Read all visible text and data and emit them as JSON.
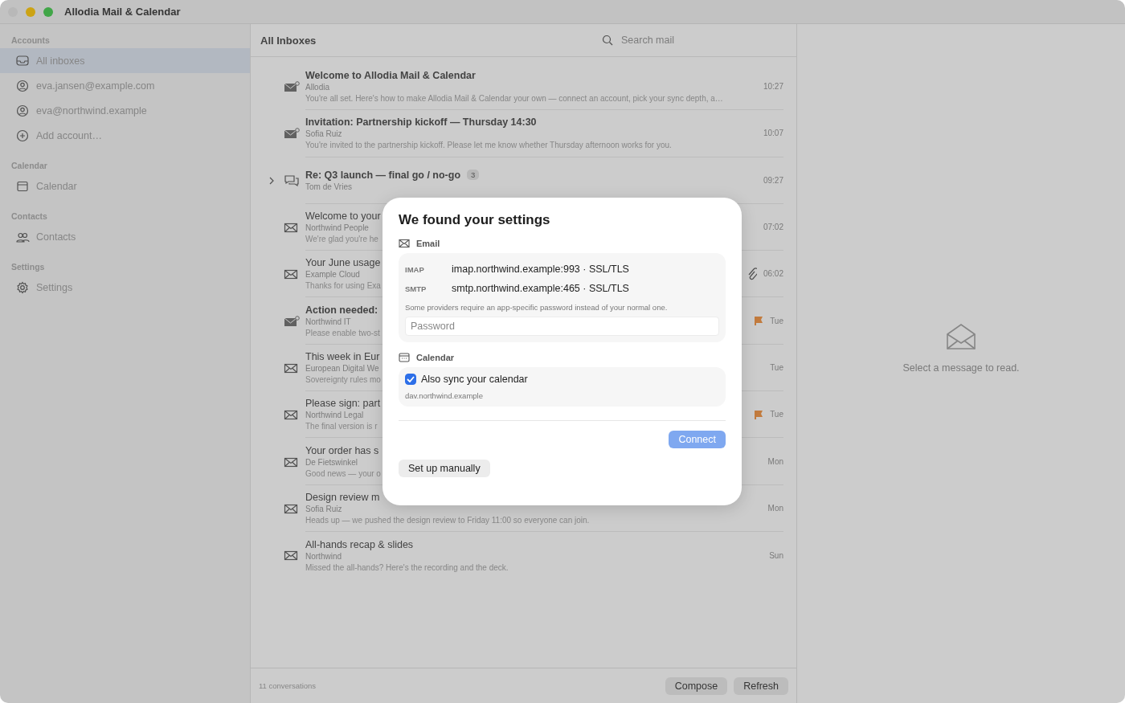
{
  "window": {
    "title": "Allodia Mail & Calendar"
  },
  "sidebar": {
    "sections": [
      {
        "heading": "Accounts",
        "items": [
          {
            "label": "All inboxes",
            "kind": "inbox",
            "selected": true
          },
          {
            "label": "eva.jansen@example.com",
            "kind": "account",
            "selected": false
          },
          {
            "label": "eva@northwind.example",
            "kind": "account",
            "selected": false
          },
          {
            "label": "Add account…",
            "kind": "add",
            "selected": false
          }
        ]
      },
      {
        "heading": "Calendar",
        "items": [
          {
            "label": "Calendar",
            "kind": "calendar",
            "selected": false
          }
        ]
      },
      {
        "heading": "Contacts",
        "items": [
          {
            "label": "Contacts",
            "kind": "contacts",
            "selected": false
          }
        ]
      },
      {
        "heading": "Settings",
        "items": [
          {
            "label": "Settings",
            "kind": "settings",
            "selected": false
          }
        ]
      }
    ]
  },
  "list": {
    "title": "All Inboxes",
    "search": {
      "placeholder": "Search mail"
    },
    "messages": [
      {
        "subject": "Welcome to Allodia Mail & Calendar",
        "sender": "Allodia",
        "preview": "You're all set. Here's how to make Allodia Mail & Calendar your own — connect an account, pick your sync depth, a…",
        "time": "10:27",
        "unread": true,
        "flagged": false,
        "attachment": false
      },
      {
        "subject": "Invitation: Partnership kickoff — Thursday 14:30",
        "sender": "Sofia Ruiz",
        "preview": "You're invited to the partnership kickoff. Please let me know whether Thursday afternoon works for you.",
        "time": "10:07",
        "unread": true,
        "flagged": false,
        "attachment": false
      },
      {
        "subject": "Re: Q3 launch — final go / no-go",
        "sender": "Tom de Vries",
        "count": "3",
        "time": "09:27",
        "unread": true,
        "flagged": false,
        "attachment": false,
        "expanded": false
      },
      {
        "subject": "Welcome to your",
        "sender": "Northwind People",
        "preview": "We're glad you're he",
        "time": "07:02",
        "unread": false,
        "flagged": false,
        "attachment": false
      },
      {
        "subject": "Your June usage",
        "sender": "Example Cloud",
        "preview": "Thanks for using Exa",
        "time": "06:02",
        "unread": false,
        "flagged": false,
        "attachment": true
      },
      {
        "subject": "Action needed:",
        "sender": "Northwind IT",
        "preview": "Please enable two-st",
        "time": "Tue",
        "unread": true,
        "flagged": true,
        "attachment": false
      },
      {
        "subject": "This week in Eur",
        "sender": "European Digital We",
        "preview": "Sovereignty rules mo",
        "time": "Tue",
        "unread": false,
        "flagged": false,
        "attachment": false
      },
      {
        "subject": "Please sign: part",
        "sender": "Northwind Legal",
        "preview": "The final version is r",
        "time": "Tue",
        "unread": false,
        "flagged": true,
        "attachment": false
      },
      {
        "subject": "Your order has s",
        "sender": "De Fietswinkel",
        "preview": "Good news — your o",
        "time": "Mon",
        "unread": false,
        "flagged": false,
        "attachment": false
      },
      {
        "subject": "Design review m",
        "sender": "Sofia Ruiz",
        "preview": "Heads up — we pushed the design review to Friday 11:00 so everyone can join.",
        "time": "Mon",
        "unread": false,
        "flagged": false,
        "attachment": false
      },
      {
        "subject": "All-hands recap & slides",
        "sender": "Northwind",
        "preview": "Missed the all-hands? Here's the recording and the deck.",
        "time": "Sun",
        "unread": false,
        "flagged": false,
        "attachment": false
      }
    ],
    "footer": {
      "count": "11 conversations",
      "buttons": [
        "Compose",
        "Refresh"
      ]
    }
  },
  "detail": {
    "empty_text": "Select a message to read."
  },
  "dialog": {
    "title": "We found your settings",
    "email": {
      "label": "Email",
      "servers": [
        {
          "protocol": "IMAP",
          "value": "imap.northwind.example:993 · SSL/TLS"
        },
        {
          "protocol": "SMTP",
          "value": "smtp.northwind.example:465 · SSL/TLS"
        }
      ],
      "note": "Some providers require an app-specific password instead of your normal one.",
      "password": {
        "placeholder": "Password"
      }
    },
    "calendar": {
      "label": "Calendar",
      "sync": {
        "label": "Also sync your calendar",
        "checked": true
      },
      "server": "dav.northwind.example"
    },
    "connect": {
      "label": "Connect",
      "disabled": true
    },
    "manual": {
      "label": "Set up manually"
    }
  }
}
